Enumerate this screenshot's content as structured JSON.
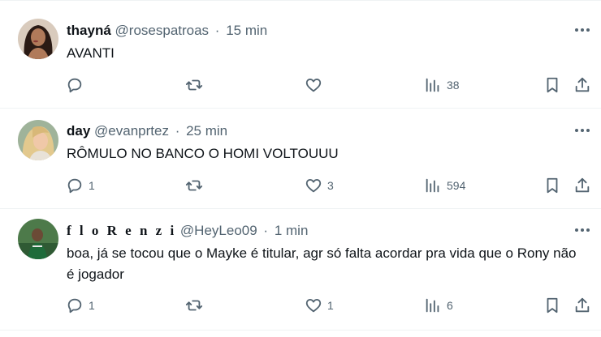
{
  "tweets": [
    {
      "name": "thayná",
      "handle": "@rosespatroas",
      "separator": "·",
      "time": "15 min",
      "text": "AVANTI",
      "replies": "",
      "retweets": "",
      "likes": "",
      "views": "38"
    },
    {
      "name": "day",
      "handle": "@evanprtez",
      "separator": "·",
      "time": "25 min",
      "text": "RÔMULO NO BANCO O HOMI VOLTOUUU",
      "replies": "1",
      "retweets": "",
      "likes": "3",
      "views": "594"
    },
    {
      "name": "f l o R e n z i",
      "handle": "@HeyLeo09",
      "separator": "·",
      "time": "1 min",
      "text": "boa, já se tocou que o Mayke é titular, agr só falta acordar pra vida que o Rony não é jogador",
      "replies": "1",
      "retweets": "",
      "likes": "1",
      "views": "6"
    }
  ],
  "icons": {
    "reply": "reply-icon",
    "retweet": "retweet-icon",
    "like": "heart-icon",
    "views": "views-chart-icon",
    "bookmark": "bookmark-icon",
    "share": "share-icon",
    "more": "more-dots-icon"
  },
  "colors": {
    "text": "#0f1419",
    "secondary": "#536471",
    "divider": "#eff3f4"
  }
}
